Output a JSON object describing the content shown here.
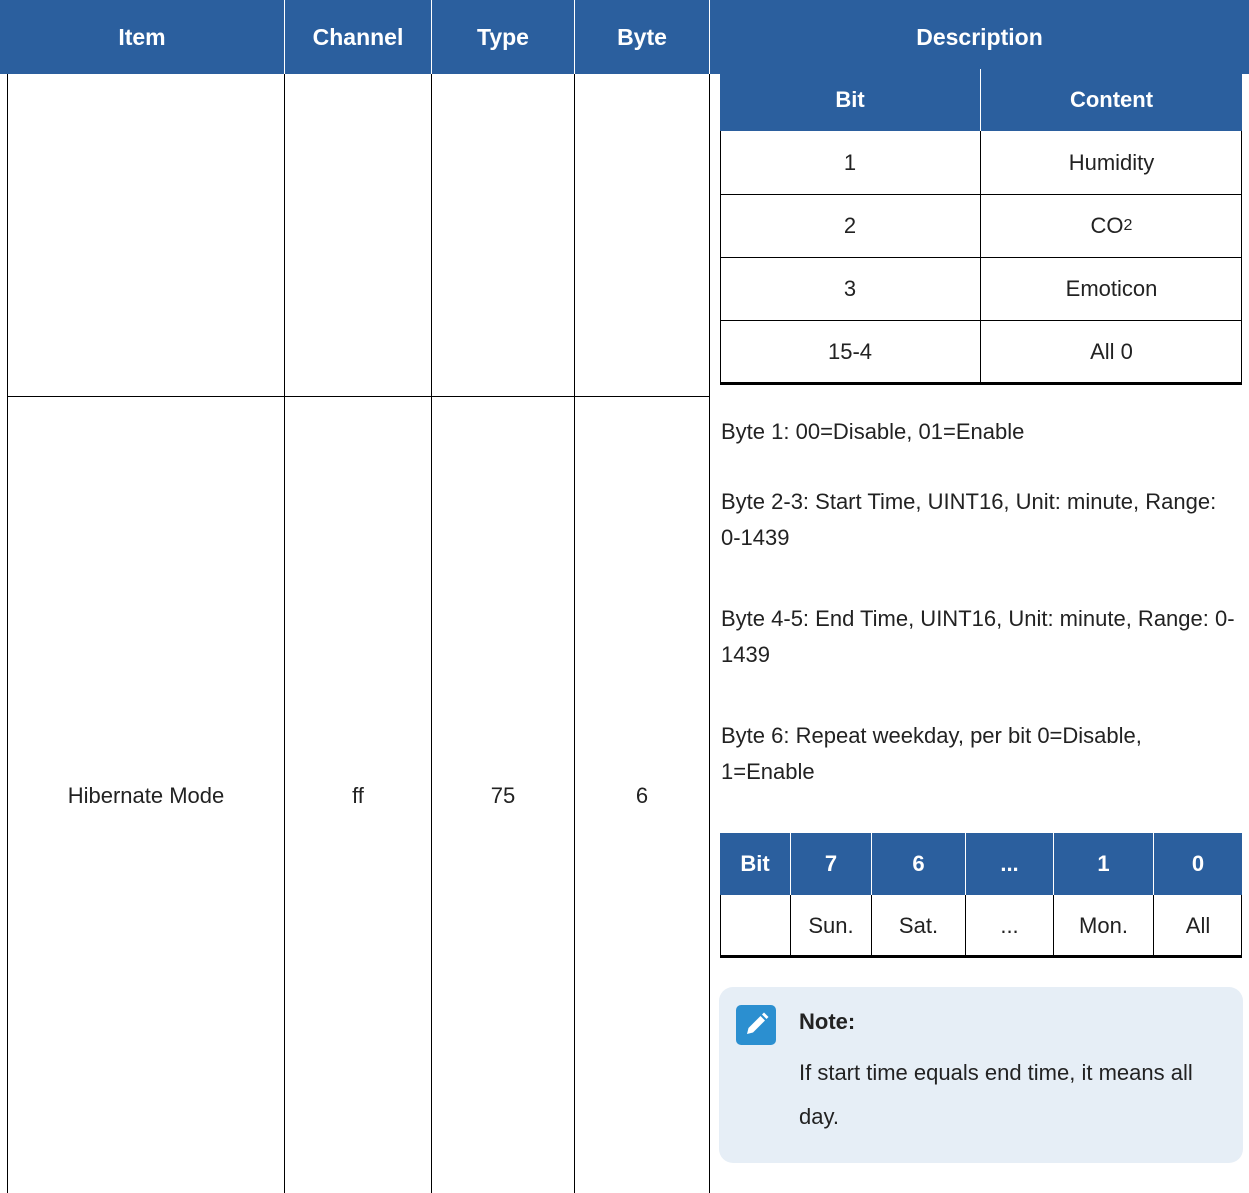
{
  "table": {
    "headers": [
      "Item",
      "Channel",
      "Type",
      "Byte",
      "Description"
    ]
  },
  "bit_table": {
    "headers": [
      "Bit",
      "Content"
    ],
    "rows": [
      {
        "bit": "1",
        "content": "Humidity"
      },
      {
        "bit": "2",
        "content": "CO",
        "sub": "2"
      },
      {
        "bit": "3",
        "content": "Emoticon"
      },
      {
        "bit": "15-4",
        "content": "All 0"
      }
    ]
  },
  "hibernate_row": {
    "item": "Hibernate Mode",
    "channel": "ff",
    "type": "75",
    "byte": "6",
    "descriptions": [
      "Byte 1: 00=Disable, 01=Enable",
      "Byte 2-3: Start Time, UINT16, Unit: minute, Range: 0-1439",
      "Byte 4-5: End Time, UINT16, Unit: minute, Range: 0-1439",
      "Byte 6: Repeat weekday, per bit 0=Disable, 1=Enable"
    ]
  },
  "weekday_table": {
    "headers": [
      "Bit",
      "7",
      "6",
      "...",
      "1",
      "0"
    ],
    "values": [
      "",
      "Sun.",
      "Sat.",
      "...",
      "Mon.",
      "All"
    ]
  },
  "note": {
    "title": "Note:",
    "text": "If start time equals end time, it means all day.",
    "icon": "pencil-icon"
  },
  "colors": {
    "header_bg": "#2b5f9e",
    "note_bg": "#e6eef6",
    "note_icon_bg": "#2b8fd0"
  }
}
